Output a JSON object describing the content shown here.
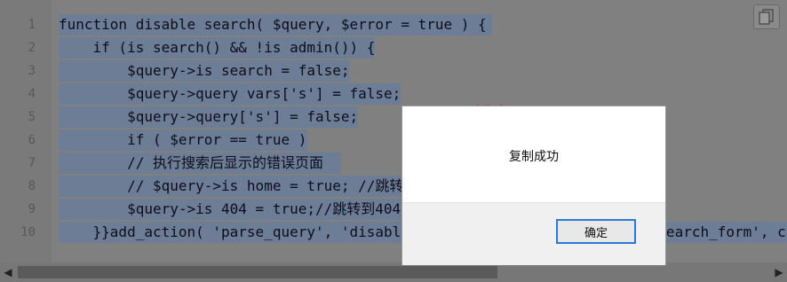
{
  "editor": {
    "line_numbers": [
      "1",
      "2",
      "3",
      "4",
      "5",
      "6",
      "7",
      "8",
      "9",
      "10"
    ],
    "lines": [
      "function disable search( $query, $error = true ) {",
      "    if (is search() && !is admin()) {",
      "        $query->is search = false;",
      "        $query->query vars['s'] = false;",
      "        $query->query['s'] = false;",
      "        if ( $error == true )",
      "        // 执行搜索后显示的错误页面",
      "        // $query->is home = true; //跳转到",
      "        $query->is 404 = true;//跳转到404",
      "    }}add_action( 'parse_query', 'disable_search' ); add_filter( 'get_search_form', cr"
    ]
  },
  "copy_button": {
    "icon": "copy-icon"
  },
  "scrollbar": {
    "left_arrow": "◀",
    "right_arrow": "▶"
  },
  "watermark": "博客吧www.boke8.net",
  "dialog": {
    "message": "复制成功",
    "ok_label": "确定"
  }
}
